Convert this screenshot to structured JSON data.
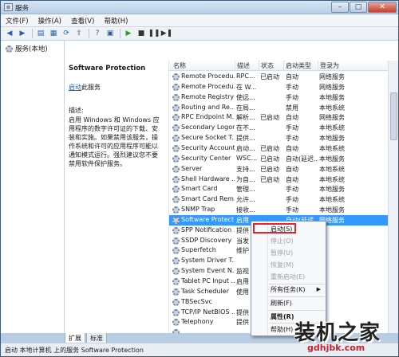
{
  "window": {
    "title": "服务"
  },
  "menu": [
    "文件(F)",
    "操作(A)",
    "查看(V)",
    "帮助(H)"
  ],
  "toolbar_icons": [
    "back-arrow-icon",
    "forward-arrow-icon",
    "console-tree-icon",
    "properties-icon",
    "refresh-icon",
    "export-icon",
    "help-icon",
    "view-icon",
    "start-icon",
    "stop-icon",
    "pause-icon",
    "restart-icon"
  ],
  "tree": {
    "root": "服务(本地)"
  },
  "description": {
    "title": "Software Protection",
    "link": "启动",
    "link_suffix": "此服务",
    "label": "描述:",
    "body": "启用 Windows 和 Windows 应用程序的数字许可证的下载、安装和实施。如果禁用该服务，操作系统和许可的应用程序可能以通知模式运行。强烈建议您不要禁用软件保护服务。"
  },
  "list": {
    "headers": [
      "名称",
      "描述",
      "状态",
      "启动类型",
      "登录为"
    ],
    "rows": [
      {
        "name": "Remote Procedu...",
        "desc": "RPC...",
        "status": "已启动",
        "start": "自动",
        "logon": "网络服务"
      },
      {
        "name": "Remote Procedu...",
        "desc": "在 W...",
        "status": "",
        "start": "手动",
        "logon": "网络服务"
      },
      {
        "name": "Remote Registry",
        "desc": "使远...",
        "status": "",
        "start": "手动",
        "logon": "本地服务"
      },
      {
        "name": "Routing and Re...",
        "desc": "在局...",
        "status": "",
        "start": "禁用",
        "logon": "本地系统"
      },
      {
        "name": "RPC Endpoint M...",
        "desc": "解析...",
        "status": "已启动",
        "start": "自动",
        "logon": "网络服务"
      },
      {
        "name": "Secondary Logon",
        "desc": "在不...",
        "status": "",
        "start": "手动",
        "logon": "本地系统"
      },
      {
        "name": "Secure Socket T...",
        "desc": "提供...",
        "status": "",
        "start": "手动",
        "logon": "本地服务"
      },
      {
        "name": "Security Account...",
        "desc": "启动...",
        "status": "已启动",
        "start": "自动",
        "logon": "本地系统"
      },
      {
        "name": "Security Center",
        "desc": "WSC...",
        "status": "已启动",
        "start": "自动(延迟...",
        "logon": "本地服务"
      },
      {
        "name": "Server",
        "desc": "支持...",
        "status": "已启动",
        "start": "自动",
        "logon": "本地系统"
      },
      {
        "name": "Shell Hardware ...",
        "desc": "为自...",
        "status": "已启动",
        "start": "自动",
        "logon": "本地系统"
      },
      {
        "name": "Smart Card",
        "desc": "管理...",
        "status": "",
        "start": "手动",
        "logon": "本地服务"
      },
      {
        "name": "Smart Card Rem...",
        "desc": "允许...",
        "status": "",
        "start": "手动",
        "logon": "本地系统"
      },
      {
        "name": "SNMP Trap",
        "desc": "接收...",
        "status": "",
        "start": "手动",
        "logon": "本地服务"
      },
      {
        "name": "Software Protect...",
        "desc": "启用",
        "status": "",
        "start": "自动(延迟...",
        "logon": "网络服务"
      },
      {
        "name": "SPP Notification ...",
        "desc": "提供",
        "status": "",
        "start": "",
        "logon": ""
      },
      {
        "name": "SSDP Discovery",
        "desc": "当发",
        "status": "",
        "start": "",
        "logon": ""
      },
      {
        "name": "Superfetch",
        "desc": "维护",
        "status": "",
        "start": "",
        "logon": ""
      },
      {
        "name": "System Driver T...",
        "desc": "",
        "status": "",
        "start": "",
        "logon": ""
      },
      {
        "name": "System Event N...",
        "desc": "监视",
        "status": "",
        "start": "",
        "logon": ""
      },
      {
        "name": "Tablet PC Input ...",
        "desc": "启用",
        "status": "",
        "start": "",
        "logon": ""
      },
      {
        "name": "Task Scheduler",
        "desc": "使用",
        "status": "",
        "start": "",
        "logon": ""
      },
      {
        "name": "TBSecSvc",
        "desc": "",
        "status": "",
        "start": "",
        "logon": ""
      },
      {
        "name": "TCP/IP NetBIOS ...",
        "desc": "提供",
        "status": "",
        "start": "",
        "logon": ""
      },
      {
        "name": "Telephony",
        "desc": "提供",
        "status": "",
        "start": "",
        "logon": ""
      },
      {
        "name": "",
        "desc": "",
        "status": "",
        "start": "",
        "logon": ""
      }
    ]
  },
  "context_menu": [
    {
      "label": "启动(S)",
      "enabled": true
    },
    {
      "label": "停止(O)",
      "enabled": false
    },
    {
      "label": "暂停(U)",
      "enabled": false
    },
    {
      "label": "恢复(M)",
      "enabled": false
    },
    {
      "label": "重新启动(E)",
      "enabled": false
    },
    {
      "label": "所有任务(K)",
      "enabled": true,
      "submenu": true
    },
    {
      "label": "刷新(F)",
      "enabled": true
    },
    {
      "label": "属性(R)",
      "enabled": true,
      "bold": true
    },
    {
      "label": "帮助(H)",
      "enabled": true
    }
  ],
  "tabs": [
    "扩展",
    "标准"
  ],
  "status": "启动 本地计算机 上的服务 Software Protection",
  "watermark": {
    "main": "装机之家",
    "url": "gdhjbk.com"
  }
}
